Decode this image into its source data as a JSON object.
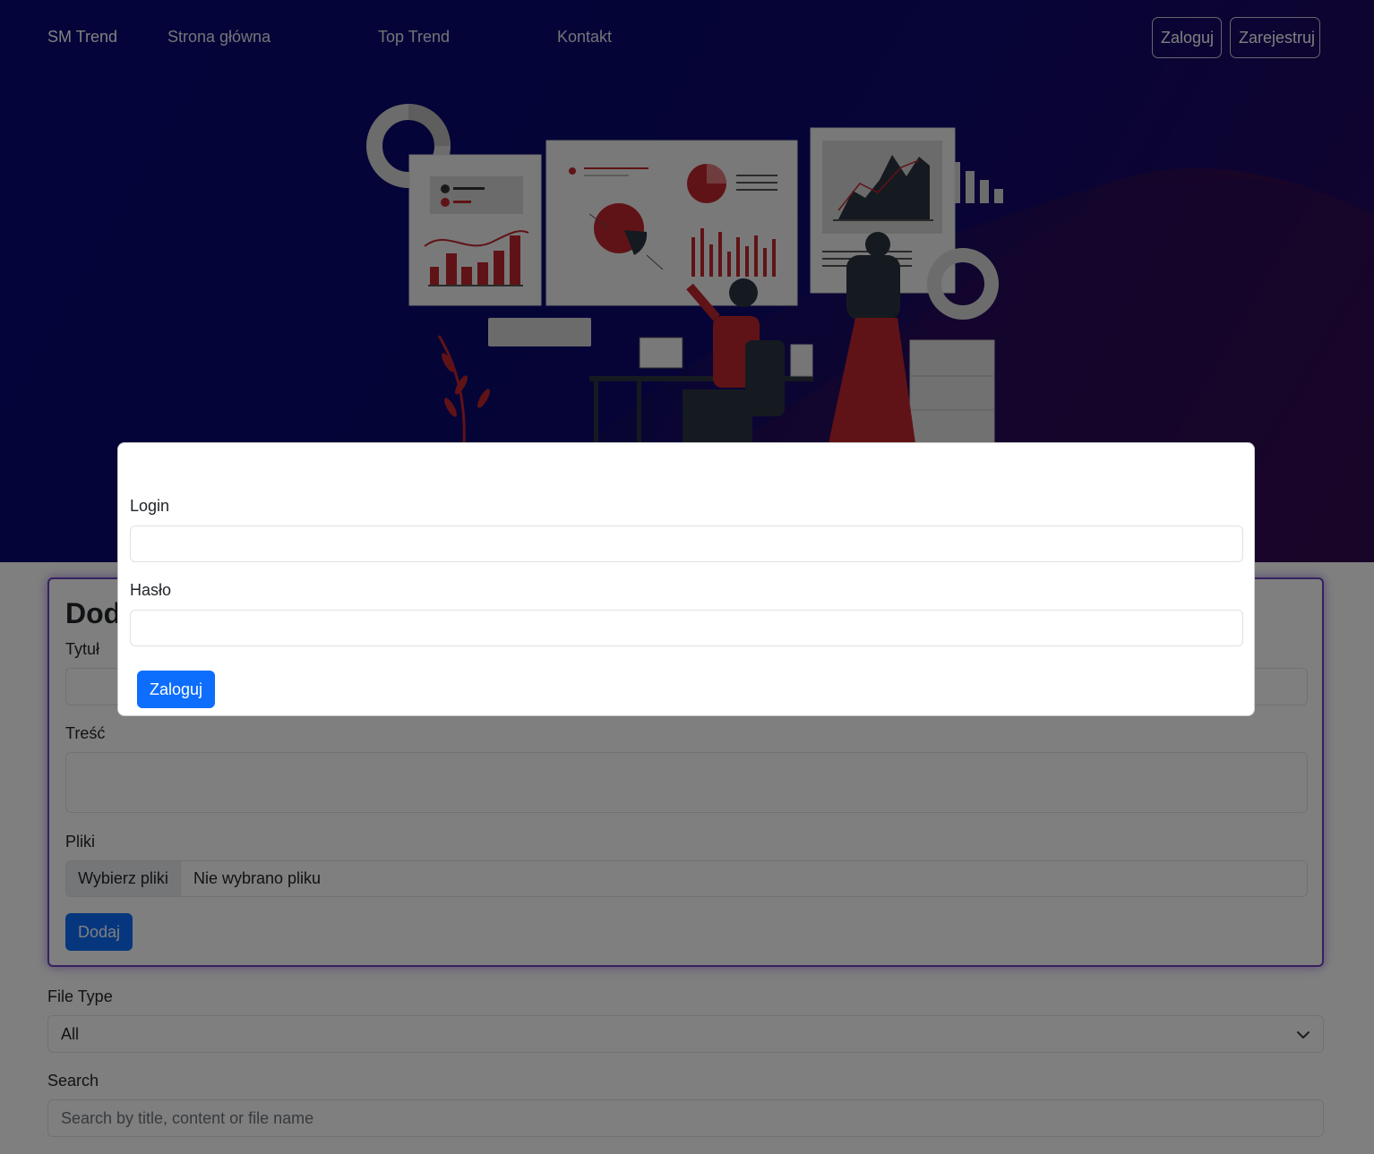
{
  "navbar": {
    "brand": "SM Trend",
    "links": [
      "Strona główna",
      "Top Trend",
      "Kontakt"
    ],
    "login_label": "Zaloguj",
    "register_label": "Zarejestruj"
  },
  "post_form": {
    "title": "Dodaj",
    "title_label": "Tytuł",
    "content_label": "Treść",
    "files_label": "Pliki",
    "files_button": "Wybierz pliki",
    "files_status": "Nie wybrano pliku",
    "submit_label": "Dodaj"
  },
  "filters": {
    "file_type_label": "File Type",
    "file_type_value": "All",
    "search_label": "Search",
    "search_placeholder": "Search by title, content or file name"
  },
  "login_modal": {
    "login_label": "Login",
    "password_label": "Hasło",
    "submit_label": "Zaloguj"
  },
  "colors": {
    "primary": "#0d6efd",
    "card_border": "#6f42c1",
    "hero_start": "#0a0a7a",
    "hero_end": "#4a0a3a",
    "illustration_red": "#c0262d"
  }
}
